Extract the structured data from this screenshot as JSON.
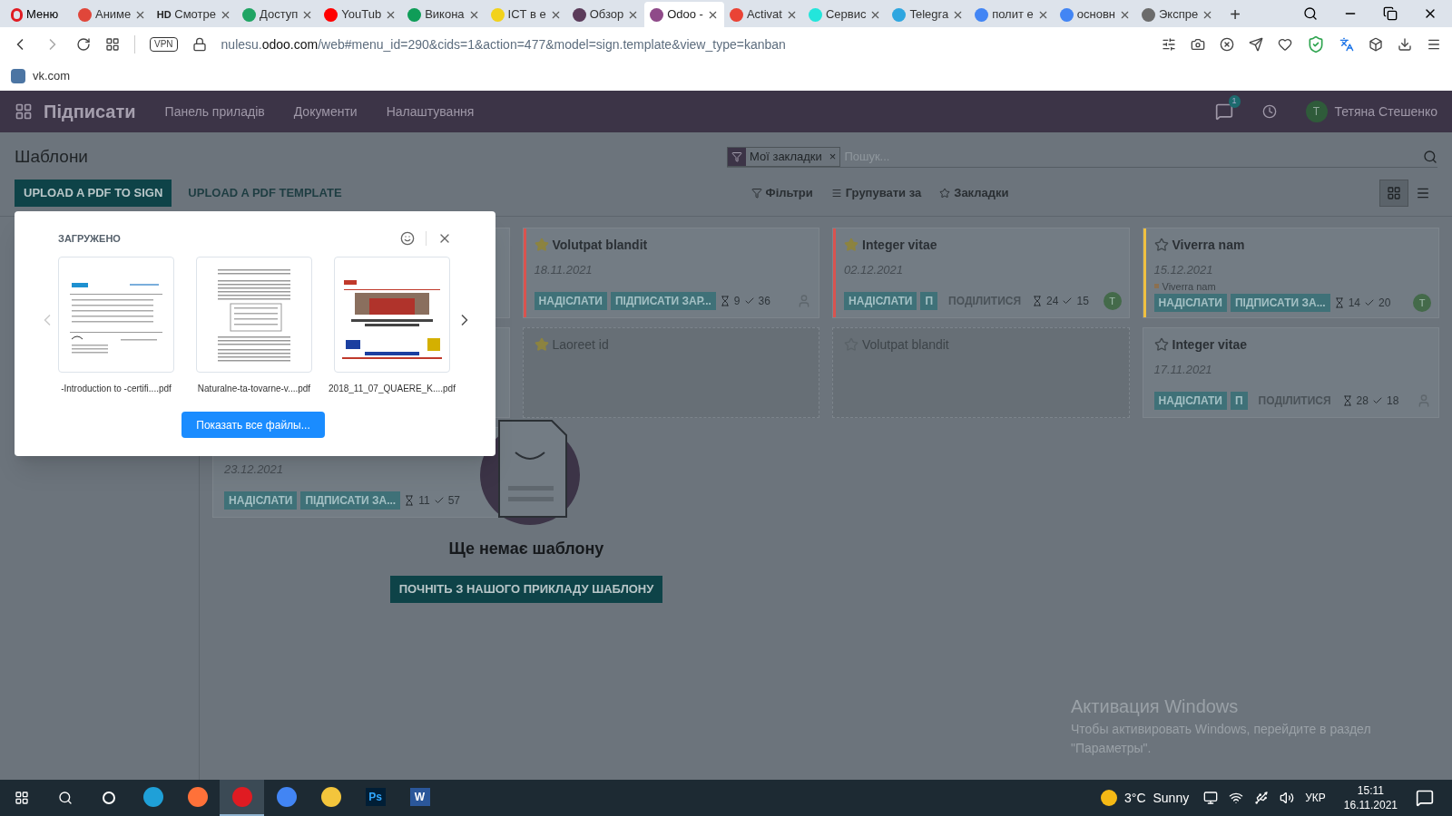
{
  "browser": {
    "menu_label": "Меню",
    "tabs": [
      {
        "title": "Аниме",
        "color": "#e0463a",
        "selected": false
      },
      {
        "title": "Смотре",
        "favicon_text": "HD",
        "color": "#222222",
        "selected": false
      },
      {
        "title": "Доступ",
        "color": "#1fa463",
        "selected": false
      },
      {
        "title": "YouTub",
        "color": "#ff0000",
        "selected": false
      },
      {
        "title": "Викона",
        "color": "#0f9d58",
        "selected": false
      },
      {
        "title": "ICT в е",
        "color": "#f2d21b",
        "selected": false
      },
      {
        "title": "Обзор",
        "color": "#5b3b5a",
        "selected": false
      },
      {
        "title": "Odoo -",
        "color": "#8f4a89",
        "selected": true
      },
      {
        "title": "Activat",
        "color": "#ea4335",
        "selected": false
      },
      {
        "title": "Сервис",
        "color": "#23e5db",
        "selected": false
      },
      {
        "title": "Telegra",
        "color": "#2ea6e0",
        "selected": false
      },
      {
        "title": "полит е",
        "color": "#4285f4",
        "selected": false
      },
      {
        "title": "основн",
        "color": "#4285f4",
        "selected": false
      },
      {
        "title": "Экспре",
        "color": "#6b6b6b",
        "selected": false
      }
    ],
    "new_tab": "+",
    "vpn": "VPN",
    "url": {
      "prefix": "nulesu.",
      "domain": "odoo.com",
      "rest": "/web#menu_id=290&cids=1&action=477&model=sign.template&view_type=kanban"
    },
    "bookmarks": [
      {
        "label": "vk.com"
      }
    ]
  },
  "navbar": {
    "app": "Підписати",
    "menu": [
      "Панель приладів",
      "Документи",
      "Налаштування"
    ],
    "messages_badge": "1",
    "user": {
      "initial": "T",
      "name": "Тетяна Стешенко"
    }
  },
  "control_panel": {
    "title": "Шаблони",
    "facet": "Мої закладки",
    "facet_remove": "×",
    "search_placeholder": "Пошук...",
    "primary_button": "UPLOAD A PDF TO SIGN",
    "secondary_button": "UPLOAD A PDF TEMPLATE",
    "filters": [
      {
        "label": "Фільтри",
        "kind": "filter"
      },
      {
        "label": "Групувати за",
        "kind": "group"
      },
      {
        "label": "Закладки",
        "kind": "star"
      }
    ],
    "views": [
      {
        "kind": "kanban",
        "selected": true
      },
      {
        "kind": "list",
        "selected": false
      }
    ]
  },
  "cards": [
    {
      "kind": "covered"
    },
    {
      "kind": "card",
      "title": "Volutpat blandit",
      "starred": true,
      "date": "18.11.2021",
      "color": "#d9534f",
      "faded": false,
      "actions": [
        {
          "label": "НАДІСЛАТИ",
          "kind": "filled"
        },
        {
          "label": "ПІДПИСАТИ ЗАР...",
          "kind": "filled"
        }
      ],
      "pending": "9",
      "signed": "36",
      "assignee": {
        "kind": "person"
      }
    },
    {
      "kind": "card",
      "title": "Integer vitae",
      "starred": true,
      "date": "02.12.2021",
      "color": "#d9534f",
      "faded": false,
      "actions": [
        {
          "label": "НАДІСЛАТИ",
          "kind": "filled"
        },
        {
          "label": "П",
          "kind": "filled"
        },
        {
          "label": "ПОДІЛИТИСЯ",
          "kind": "link"
        }
      ],
      "pending": "24",
      "signed": "15",
      "assignee": {
        "kind": "avatar",
        "initial": "T"
      }
    },
    {
      "kind": "card",
      "title": "Viverra nam",
      "starred": false,
      "date": "15.12.2021",
      "tag": "Viverra nam",
      "color": "#f0c040",
      "faded": false,
      "actions": [
        {
          "label": "НАДІСЛАТИ",
          "kind": "filled"
        },
        {
          "label": "ПІДПИСАТИ ЗА...",
          "kind": "filled"
        }
      ],
      "pending": "14",
      "signed": "20",
      "assignee": {
        "kind": "avatar",
        "initial": "T"
      }
    },
    {
      "kind": "covered"
    },
    {
      "kind": "card",
      "title": "Laoreet id",
      "starred": true,
      "faded": true
    },
    {
      "kind": "card",
      "title": "Volutpat blandit",
      "starred": false,
      "faded": true
    },
    {
      "kind": "card",
      "title": "Integer vitae",
      "starred": false,
      "date": "17.11.2021",
      "faded": false,
      "actions": [
        {
          "label": "НАДІСЛАТИ",
          "kind": "filled"
        },
        {
          "label": "П",
          "kind": "filled"
        },
        {
          "label": "ПОДІЛИТИСЯ",
          "kind": "link"
        }
      ],
      "pending": "28",
      "signed": "18",
      "assignee": {
        "kind": "person"
      }
    },
    {
      "kind": "card",
      "date": "23.12.2021",
      "faded": false,
      "actions": [
        {
          "label": "НАДІСЛАТИ",
          "kind": "filled"
        },
        {
          "label": "ПІДПИСАТИ ЗА...",
          "kind": "filled"
        }
      ],
      "pending": "11",
      "signed": "57"
    }
  ],
  "empty_state": {
    "title": "Ще немає шаблону",
    "button": "ПОЧНІТЬ З НАШОГО ПРИКЛАДУ ШАБЛОНУ"
  },
  "downloads_popup": {
    "title": "ЗАГРУЖЕНО",
    "files": [
      {
        "name": "-Introduction to -certifi....pdf",
        "kind": "certificate"
      },
      {
        "name": "Naturalne-ta-tovarne-v....pdf",
        "kind": "text"
      },
      {
        "name": "2018_11_07_QUAERE_K....pdf",
        "kind": "poster"
      }
    ],
    "show_all": "Показать все файлы..."
  },
  "activation_notice": {
    "title": "Активация Windows",
    "text": "Чтобы активировать Windows, перейдите в раздел \"Параметры\"."
  },
  "taskbar": {
    "apps": [
      {
        "kind": "edge",
        "active": false
      },
      {
        "kind": "firefox",
        "active": false
      },
      {
        "kind": "opera",
        "active": true
      },
      {
        "kind": "chrome",
        "active": false
      },
      {
        "kind": "explorer",
        "active": false
      },
      {
        "kind": "photoshop",
        "label": "Ps",
        "active": false
      },
      {
        "kind": "word",
        "label": "W",
        "active": false
      }
    ],
    "weather": {
      "temp": "3°C",
      "text": "Sunny"
    },
    "language": "УКР",
    "time": "15:11",
    "date": "16.11.2021"
  }
}
